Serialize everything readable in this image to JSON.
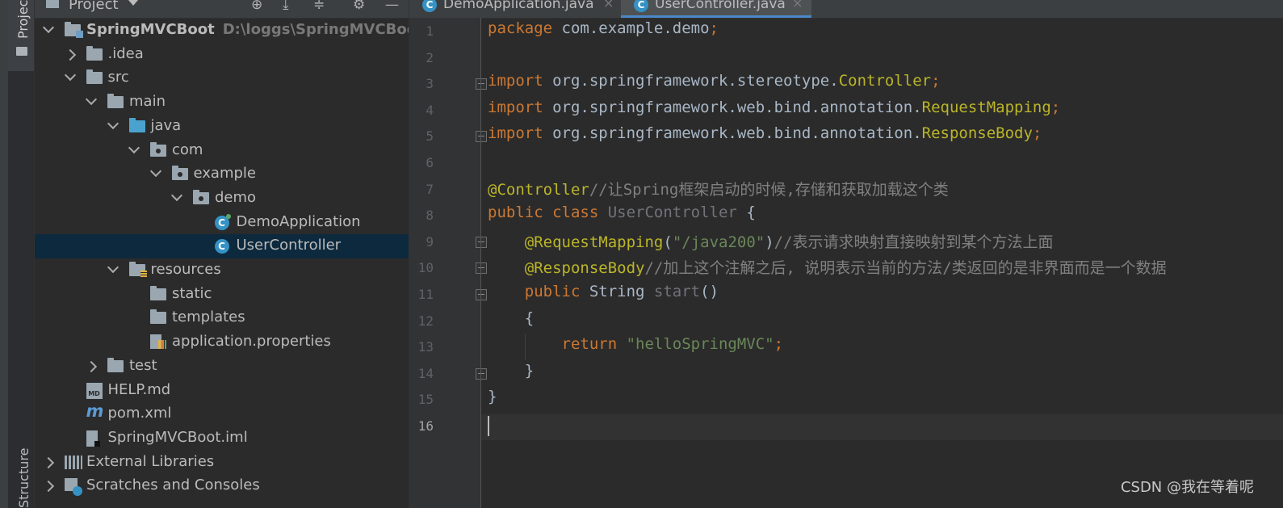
{
  "side_tabs": {
    "project": "Project",
    "structure": "Structure"
  },
  "project_panel": {
    "title": "Project",
    "tree": [
      {
        "label": "SpringMVCBoot",
        "hint": "D:\\loggs\\SpringMVCBoot",
        "icon": "project-folder-icon",
        "expanded": true
      },
      {
        "label": ".idea",
        "icon": "folder-icon",
        "expanded": false
      },
      {
        "label": "src",
        "icon": "folder-icon",
        "expanded": true
      },
      {
        "label": "main",
        "icon": "folder-icon",
        "expanded": true
      },
      {
        "label": "java",
        "icon": "source-folder-icon",
        "expanded": true
      },
      {
        "label": "com",
        "icon": "package-icon",
        "expanded": true
      },
      {
        "label": "example",
        "icon": "package-icon",
        "expanded": true
      },
      {
        "label": "demo",
        "icon": "package-icon",
        "expanded": true
      },
      {
        "label": "DemoApplication",
        "icon": "spring-class-icon"
      },
      {
        "label": "UserController",
        "icon": "class-icon",
        "selected": true
      },
      {
        "label": "resources",
        "icon": "resources-folder-icon",
        "expanded": true
      },
      {
        "label": "static",
        "icon": "folder-icon"
      },
      {
        "label": "templates",
        "icon": "folder-icon"
      },
      {
        "label": "application.properties",
        "icon": "properties-file-icon"
      },
      {
        "label": "test",
        "icon": "folder-icon",
        "expanded": false
      },
      {
        "label": "HELP.md",
        "icon": "markdown-file-icon"
      },
      {
        "label": "pom.xml",
        "icon": "maven-file-icon"
      },
      {
        "label": "SpringMVCBoot.iml",
        "icon": "module-file-icon"
      },
      {
        "label": "External Libraries",
        "icon": "libraries-icon",
        "expanded": false
      },
      {
        "label": "Scratches and Consoles",
        "icon": "scratches-icon",
        "expanded": false
      }
    ]
  },
  "editor": {
    "tabs": [
      {
        "label": "DemoApplication.java",
        "active": false
      },
      {
        "label": "UserController.java",
        "active": true
      }
    ],
    "current_line": 16,
    "lines": [
      [
        {
          "t": "package ",
          "c": "kw"
        },
        {
          "t": "com.example.demo",
          "c": ""
        },
        {
          "t": ";",
          "c": "kw"
        }
      ],
      [],
      [
        {
          "t": "import ",
          "c": "kw"
        },
        {
          "t": "org.springframework.stereotype.",
          "c": ""
        },
        {
          "t": "Controller",
          "c": "imp"
        },
        {
          "t": ";",
          "c": "kw"
        }
      ],
      [
        {
          "t": "import ",
          "c": "kw"
        },
        {
          "t": "org.springframework.web.bind.annotation.",
          "c": ""
        },
        {
          "t": "RequestMapping",
          "c": "imp"
        },
        {
          "t": ";",
          "c": "kw"
        }
      ],
      [
        {
          "t": "import ",
          "c": "kw"
        },
        {
          "t": "org.springframework.web.bind.annotation.",
          "c": ""
        },
        {
          "t": "ResponseBody",
          "c": "imp"
        },
        {
          "t": ";",
          "c": "kw"
        }
      ],
      [],
      [
        {
          "t": "@Controller",
          "c": "ann"
        },
        {
          "t": "//让Spring框架启动的时候,存储和获取加载这个类",
          "c": "cmt"
        }
      ],
      [
        {
          "t": "public class ",
          "c": "kw"
        },
        {
          "t": "UserController",
          "c": "unused"
        },
        {
          "t": " {",
          "c": ""
        }
      ],
      [
        {
          "t": "    ",
          "c": ""
        },
        {
          "t": "@RequestMapping",
          "c": "ann"
        },
        {
          "t": "(",
          "c": ""
        },
        {
          "t": "\"/java200\"",
          "c": "str"
        },
        {
          "t": ")",
          "c": ""
        },
        {
          "t": "//表示请求映射直接映射到某个方法上面",
          "c": "cmt"
        }
      ],
      [
        {
          "t": "    ",
          "c": ""
        },
        {
          "t": "@ResponseBody",
          "c": "ann"
        },
        {
          "t": "//加上这个注解之后, 说明表示当前的方法/类返回的是非界面而是一个数据",
          "c": "cmt"
        }
      ],
      [
        {
          "t": "    ",
          "c": ""
        },
        {
          "t": "public ",
          "c": "kw"
        },
        {
          "t": "String ",
          "c": ""
        },
        {
          "t": "start",
          "c": "unused"
        },
        {
          "t": "()",
          "c": ""
        }
      ],
      [
        {
          "t": "    {",
          "c": ""
        }
      ],
      [
        {
          "t": "        ",
          "c": ""
        },
        {
          "t": "return ",
          "c": "kw"
        },
        {
          "t": "\"helloSpringMVC\"",
          "c": "str"
        },
        {
          "t": ";",
          "c": "kw"
        }
      ],
      [
        {
          "t": "    }",
          "c": ""
        }
      ],
      [
        {
          "t": "}",
          "c": ""
        }
      ],
      []
    ]
  },
  "watermark": "CSDN @我在等着呢"
}
